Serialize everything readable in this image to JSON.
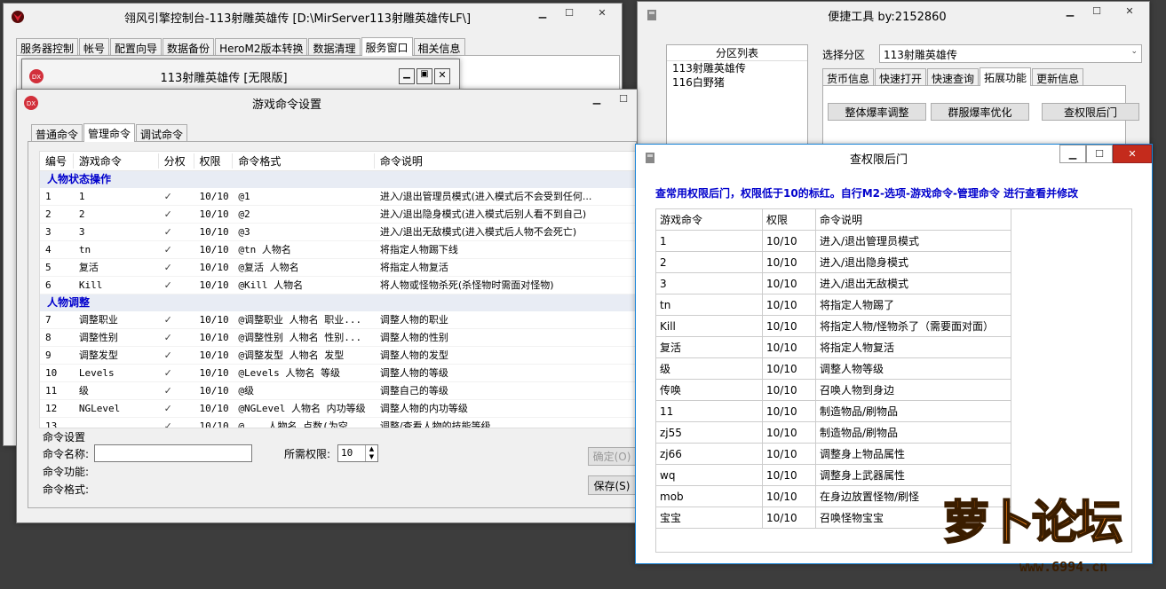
{
  "main_window": {
    "title": "翎风引擎控制台-113射雕英雄传 [D:\\MirServer113射雕英雄传LF\\]",
    "tabs": [
      "服务器控制",
      "帐号",
      "配置向导",
      "数据备份",
      "HeroM2版本转换",
      "数据清理",
      "服务窗口",
      "相关信息"
    ],
    "active_tab": 6
  },
  "sub_window": {
    "title": "113射雕英雄传 [无限版]"
  },
  "game_cmd": {
    "title": "游戏命令设置",
    "tabs": [
      "普通命令",
      "管理命令",
      "调试命令"
    ],
    "active_tab": 1,
    "columns": [
      "编号",
      "游戏命令",
      "分权",
      "权限",
      "命令格式",
      "命令说明"
    ],
    "groups": [
      {
        "name": "人物状态操作",
        "rows": [
          [
            "1",
            "1",
            "✓",
            "10/10",
            "@1",
            "进入/退出管理员模式(进入模式后不会受到任何..."
          ],
          [
            "2",
            "2",
            "✓",
            "10/10",
            "@2",
            "进入/退出隐身模式(进入模式后别人看不到自己)"
          ],
          [
            "3",
            "3",
            "✓",
            "10/10",
            "@3",
            "进入/退出无敌模式(进入模式后人物不会死亡)"
          ],
          [
            "4",
            "tn",
            "✓",
            "10/10",
            "@tn 人物名",
            "将指定人物踢下线"
          ],
          [
            "5",
            "复活",
            "✓",
            "10/10",
            "@复活 人物名",
            "将指定人物复活"
          ],
          [
            "6",
            "Kill",
            "✓",
            "10/10",
            "@Kill 人物名",
            "将人物或怪物杀死(杀怪物时需面对怪物)"
          ]
        ]
      },
      {
        "name": "人物调整",
        "rows": [
          [
            "7",
            "调整职业",
            "✓",
            "10/10",
            "@调整职业 人物名 职业...",
            "调整人物的职业"
          ],
          [
            "8",
            "调整性别",
            "✓",
            "10/10",
            "@调整性别 人物名 性别...",
            "调整人物的性别"
          ],
          [
            "9",
            "调整发型",
            "✓",
            "10/10",
            "@调整发型 人物名 发型",
            "调整人物的发型"
          ],
          [
            "10",
            "Levels",
            "✓",
            "10/10",
            "@Levels 人物名 等级",
            "调整人物的等级"
          ],
          [
            "11",
            "级",
            "✓",
            "10/10",
            "@级",
            "调整自己的等级"
          ],
          [
            "12",
            "NGLevel",
            "✓",
            "10/10",
            "@NGLevel 人物名 内功等级",
            "调整人物的内功等级"
          ],
          [
            "13",
            "...",
            "✓",
            "10/10",
            "@... 人物名 点数(为空...",
            "调整/查看人物的技能等级"
          ]
        ]
      }
    ],
    "settings": {
      "group_label": "命令设置",
      "name_label": "命令名称:",
      "func_label": "命令功能:",
      "format_label": "命令格式:",
      "perm_label": "所需权限:",
      "perm_value": "10",
      "ok_label": "确定(O)",
      "save_label": "保存(S)"
    }
  },
  "tool_window": {
    "title": "便捷工具 by:2152860",
    "partition_header": "分区列表",
    "partitions": [
      "113射雕英雄传",
      "116白野猪"
    ],
    "select_label": "选择分区",
    "select_value": "113射雕英雄传",
    "tabs": [
      "货币信息",
      "快速打开",
      "快速查询",
      "拓展功能",
      "更新信息"
    ],
    "active_tab": 3,
    "buttons": [
      "整体爆率调整",
      "群服爆率优化",
      "查权限后门"
    ]
  },
  "backdoor": {
    "title": "查权限后门",
    "notice": "查常用权限后门，权限低于10的标红。自行M2-选项-游戏命令-管理命令 进行查看并修改",
    "columns": [
      "游戏命令",
      "权限",
      "命令说明"
    ],
    "rows": [
      [
        "1",
        "10/10",
        "进入/退出管理员模式"
      ],
      [
        "2",
        "10/10",
        "进入/退出隐身模式"
      ],
      [
        "3",
        "10/10",
        "进入/退出无敌模式"
      ],
      [
        "tn",
        "10/10",
        "将指定人物踢了"
      ],
      [
        "Kill",
        "10/10",
        "将指定人物/怪物杀了（需要面对面）"
      ],
      [
        "复活",
        "10/10",
        "将指定人物复活"
      ],
      [
        "级",
        "10/10",
        "调整人物等级"
      ],
      [
        "传唤",
        "10/10",
        "召唤人物到身边"
      ],
      [
        "11",
        "10/10",
        "制造物品/刷物品"
      ],
      [
        "zj55",
        "10/10",
        "制造物品/刷物品"
      ],
      [
        "zj66",
        "10/10",
        "调整身上物品属性"
      ],
      [
        "wq",
        "10/10",
        "调整身上武器属性"
      ],
      [
        "mob",
        "10/10",
        "在身边放置怪物/刷怪"
      ],
      [
        "宝宝",
        "10/10",
        "召唤怪物宝宝"
      ]
    ]
  },
  "watermark": {
    "text": "萝卜论坛",
    "url": "www.6994.cn"
  },
  "colors": {
    "title_active": "#ffffff",
    "group_text": "#0000cc",
    "notice_text": "#0000cc",
    "backdoor_border": "#1883d7"
  }
}
